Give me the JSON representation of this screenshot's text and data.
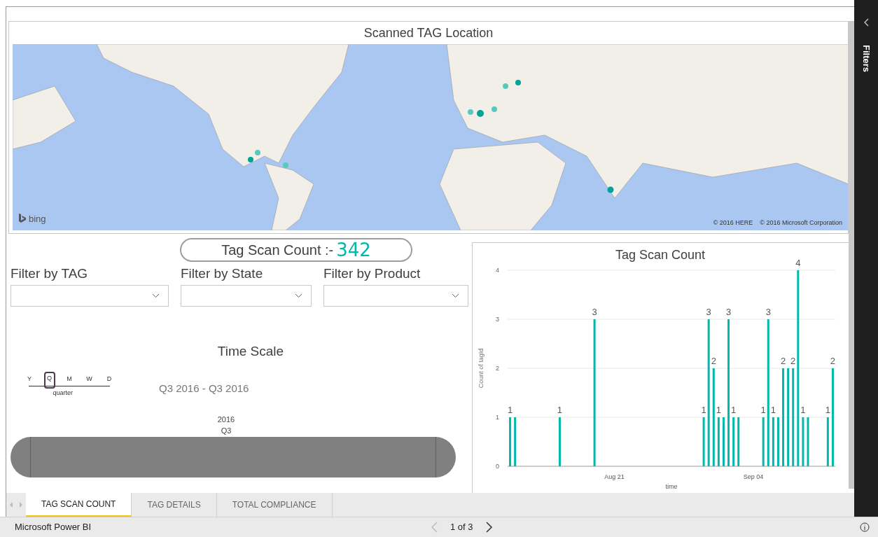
{
  "map": {
    "title": "Scanned TAG Location",
    "logo": "bing",
    "credits": [
      "© 2016 HERE",
      "© 2016 Microsoft Corporation"
    ]
  },
  "count_card": {
    "label": "Tag Scan Count :-",
    "value": "342"
  },
  "filters": [
    {
      "label": "Filter by TAG"
    },
    {
      "label": "Filter by State"
    },
    {
      "label": "Filter by Product"
    }
  ],
  "time_scale": {
    "title": "Time Scale",
    "levels": [
      {
        "label": "Y",
        "selected": false
      },
      {
        "label": "Q",
        "selected": true
      },
      {
        "label": "M",
        "selected": false
      },
      {
        "label": "W",
        "selected": false
      },
      {
        "label": "D",
        "selected": false
      }
    ],
    "level_caption": "quarter",
    "range": "Q3 2016 - Q3 2016",
    "periods": [
      {
        "year": "2016",
        "label": "Q3",
        "selected": true
      }
    ]
  },
  "chart": {
    "chart_data": {
      "type": "bar",
      "title": "Tag Scan Count",
      "xlabel": "time",
      "ylabel": "Count of tagId",
      "grid": true,
      "value_labels": [
        "1",
        null,
        null,
        null,
        null,
        null,
        null,
        null,
        null,
        null,
        "1",
        null,
        null,
        null,
        null,
        null,
        null,
        "3",
        null,
        null,
        null,
        null,
        null,
        null,
        null,
        null,
        null,
        null,
        null,
        null,
        null,
        null,
        null,
        null,
        null,
        null,
        null,
        null,
        null,
        "1",
        "3",
        "2",
        "1",
        null,
        "3",
        "1",
        null,
        null,
        null,
        null,
        null,
        "1",
        "3",
        "1",
        null,
        "2",
        null,
        "2",
        "4",
        "1",
        null,
        null,
        null,
        null,
        "1",
        "2"
      ],
      "categories": [
        null,
        null,
        null,
        null,
        null,
        null,
        null,
        null,
        null,
        null,
        null,
        null,
        null,
        null,
        null,
        null,
        null,
        null,
        null,
        null,
        null,
        "Aug 21",
        null,
        null,
        null,
        null,
        null,
        null,
        null,
        null,
        null,
        null,
        null,
        null,
        null,
        null,
        null,
        null,
        null,
        null,
        null,
        null,
        null,
        null,
        null,
        null,
        null,
        null,
        null,
        "Sep 04",
        null,
        null,
        null,
        null,
        null,
        null,
        null,
        null,
        null,
        null,
        null,
        null,
        null,
        null,
        null,
        null
      ],
      "series": [
        {
          "color": "#01b8aa",
          "values": [
            1,
            1,
            null,
            null,
            null,
            null,
            null,
            null,
            null,
            null,
            1,
            null,
            null,
            null,
            null,
            null,
            null,
            3,
            null,
            null,
            null,
            null,
            null,
            null,
            null,
            null,
            null,
            null,
            null,
            null,
            null,
            null,
            null,
            null,
            null,
            null,
            null,
            null,
            null,
            1,
            3,
            2,
            1,
            1,
            3,
            1,
            1,
            null,
            null,
            null,
            null,
            1,
            3,
            1,
            1,
            2,
            2,
            2,
            4,
            1,
            1,
            null,
            null,
            null,
            1,
            2
          ]
        }
      ],
      "ylim": [
        0,
        4
      ],
      "yticks": [
        0,
        1,
        2,
        3,
        4
      ]
    }
  },
  "tabs": [
    {
      "label": "TAG SCAN COUNT",
      "selected": true
    },
    {
      "label": "TAG DETAILS",
      "selected": false
    },
    {
      "label": "TOTAL COMPLIANCE",
      "selected": false
    }
  ],
  "footer": {
    "app": "Microsoft Power BI",
    "pager": "1 of 3"
  },
  "filters_pane": {
    "label": "Filters"
  }
}
